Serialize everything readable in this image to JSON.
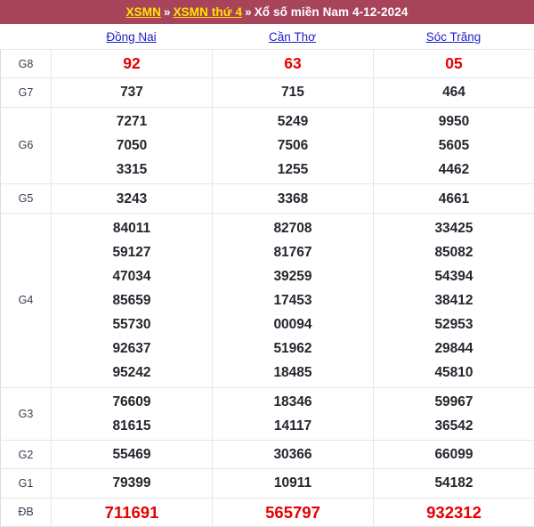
{
  "title_bar": {
    "link1": "XSMN",
    "sep1": "»",
    "link2": "XSMN thứ 4",
    "sep2": "»",
    "rest": "Xổ số miền Nam 4-12-2024",
    "background_color": "#a8445a",
    "link_color": "#ffe400",
    "text_color": "#ffffff"
  },
  "provinces": [
    {
      "name": "Đồng Nai"
    },
    {
      "name": "Cần Thơ"
    },
    {
      "name": "Sóc Trăng"
    }
  ],
  "colors": {
    "highlight_red": "#e60000",
    "number_text": "#23272e",
    "prize_label": "#35404d",
    "province_link": "#1f20c8",
    "grid_line": "#e6e6e6"
  },
  "rows": [
    {
      "prize": "G8",
      "style": "red",
      "cells": [
        [
          "92"
        ],
        [
          "63"
        ],
        [
          "05"
        ]
      ]
    },
    {
      "prize": "G7",
      "style": "normal",
      "cells": [
        [
          "737"
        ],
        [
          "715"
        ],
        [
          "464"
        ]
      ]
    },
    {
      "prize": "G6",
      "style": "normal",
      "cells": [
        [
          "7271",
          "7050",
          "3315"
        ],
        [
          "5249",
          "7506",
          "1255"
        ],
        [
          "9950",
          "5605",
          "4462"
        ]
      ]
    },
    {
      "prize": "G5",
      "style": "normal",
      "cells": [
        [
          "3243"
        ],
        [
          "3368"
        ],
        [
          "4661"
        ]
      ]
    },
    {
      "prize": "G4",
      "style": "normal",
      "cells": [
        [
          "84011",
          "59127",
          "47034",
          "85659",
          "55730",
          "92637",
          "95242"
        ],
        [
          "82708",
          "81767",
          "39259",
          "17453",
          "00094",
          "51962",
          "18485"
        ],
        [
          "33425",
          "85082",
          "54394",
          "38412",
          "52953",
          "29844",
          "45810"
        ]
      ]
    },
    {
      "prize": "G3",
      "style": "normal",
      "cells": [
        [
          "76609",
          "81615"
        ],
        [
          "18346",
          "14117"
        ],
        [
          "59967",
          "36542"
        ]
      ]
    },
    {
      "prize": "G2",
      "style": "normal",
      "cells": [
        [
          "55469"
        ],
        [
          "30366"
        ],
        [
          "66099"
        ]
      ]
    },
    {
      "prize": "G1",
      "style": "normal",
      "cells": [
        [
          "79399"
        ],
        [
          "10911"
        ],
        [
          "54182"
        ]
      ]
    },
    {
      "prize": "ĐB",
      "style": "db",
      "cells": [
        [
          "711691"
        ],
        [
          "565797"
        ],
        [
          "932312"
        ]
      ]
    }
  ]
}
